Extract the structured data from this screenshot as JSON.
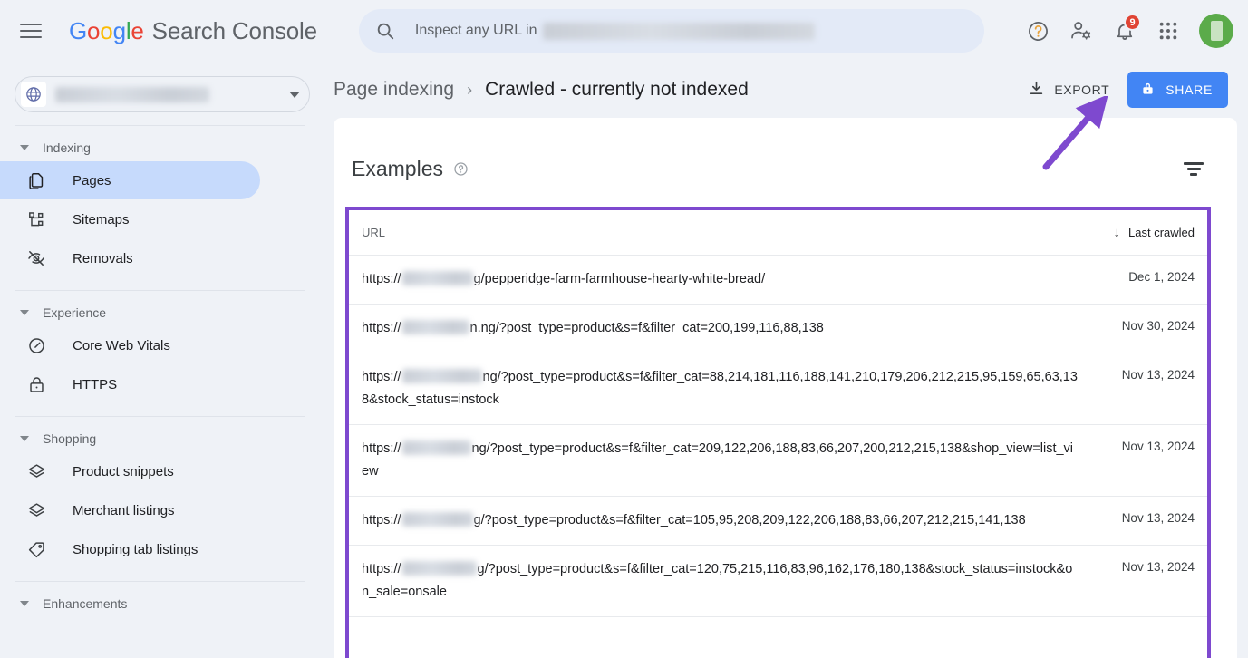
{
  "app": {
    "brand_google": [
      "G",
      "o",
      "o",
      "g",
      "l",
      "e"
    ],
    "brand_suffix": "Search Console"
  },
  "search": {
    "placeholder_text": "Inspect any URL in",
    "icon": "search-icon",
    "redacted_domain": true
  },
  "topbar": {
    "menu_icon": "hamburger-menu-icon",
    "help_icon": "help-circle-icon",
    "account_settings_icon": "user-settings-icon",
    "notifications_icon": "bell-icon",
    "notifications_count": "9",
    "apps_icon": "apps-grid-icon",
    "avatar_icon": "avatar"
  },
  "sidebar": {
    "property_selector": {
      "icon": "globe-icon",
      "redacted_property": true,
      "caret_icon": "chevron-down-icon"
    },
    "groups": [
      {
        "label": "Indexing",
        "items": [
          {
            "label": "Pages",
            "icon": "pages-icon",
            "active": true
          },
          {
            "label": "Sitemaps",
            "icon": "sitemaps-icon",
            "active": false
          },
          {
            "label": "Removals",
            "icon": "eye-off-icon",
            "active": false
          }
        ]
      },
      {
        "label": "Experience",
        "items": [
          {
            "label": "Core Web Vitals",
            "icon": "speedometer-icon",
            "active": false
          },
          {
            "label": "HTTPS",
            "icon": "lock-icon",
            "active": false
          }
        ]
      },
      {
        "label": "Shopping",
        "items": [
          {
            "label": "Product snippets",
            "icon": "layers-icon",
            "active": false
          },
          {
            "label": "Merchant listings",
            "icon": "layers-icon",
            "active": false
          },
          {
            "label": "Shopping tab listings",
            "icon": "tag-icon",
            "active": false
          }
        ]
      },
      {
        "label": "Enhancements",
        "items": []
      }
    ]
  },
  "header": {
    "breadcrumb_parent": "Page indexing",
    "breadcrumb_separator": "›",
    "breadcrumb_current": "Crawled - currently not indexed",
    "export_label": "EXPORT",
    "export_icon": "download-icon",
    "share_label": "SHARE",
    "share_icon": "lock-icon"
  },
  "examples_card": {
    "title": "Examples",
    "help_icon": "help-circle-icon",
    "filter_icon": "filter-icon"
  },
  "table": {
    "columns": {
      "url": "URL",
      "last_crawled": "Last crawled",
      "sort_arrow": "↓"
    },
    "rows": [
      {
        "url_prefix": "https://",
        "url_suffix": "g/pepperidge-farm-farmhouse-hearty-white-bread/",
        "redact_width": 78,
        "last_crawled": "Dec 1, 2024"
      },
      {
        "url_prefix": "https://",
        "url_suffix": "n.ng/?post_type=product&s=f&filter_cat=200,199,116,88,138",
        "redact_width": 74,
        "last_crawled": "Nov 30, 2024"
      },
      {
        "url_prefix": "https://",
        "url_suffix": "ng/?post_type=product&s=f&filter_cat=88,214,181,116,188,141,210,179,206,212,215,95,159,65,63,138&stock_status=instock",
        "redact_width": 88,
        "last_crawled": "Nov 13, 2024"
      },
      {
        "url_prefix": "https://",
        "url_suffix": "ng/?post_type=product&s=f&filter_cat=209,122,206,188,83,66,207,200,212,215,138&shop_view=list_view",
        "redact_width": 76,
        "last_crawled": "Nov 13, 2024"
      },
      {
        "url_prefix": "https://",
        "url_suffix": "g/?post_type=product&s=f&filter_cat=105,95,208,209,122,206,188,83,66,207,212,215,141,138",
        "redact_width": 78,
        "last_crawled": "Nov 13, 2024"
      },
      {
        "url_prefix": "https://",
        "url_suffix": "g/?post_type=product&s=f&filter_cat=120,75,215,116,83,96,162,176,180,138&stock_status=instock&on_sale=onsale",
        "redact_width": 82,
        "last_crawled": "Nov 13, 2024"
      }
    ]
  },
  "annotations": {
    "arrow_color": "#7e49cf",
    "highlight_border_color": "#7e49cf",
    "arrow_target": "EXPORT"
  },
  "colors": {
    "page_background": "#eff2f7",
    "card_background": "#ffffff",
    "active_nav": "#c6dafc",
    "share_button": "#4285f4",
    "badge_red": "#e04434",
    "avatar_green": "#5bab4a"
  }
}
